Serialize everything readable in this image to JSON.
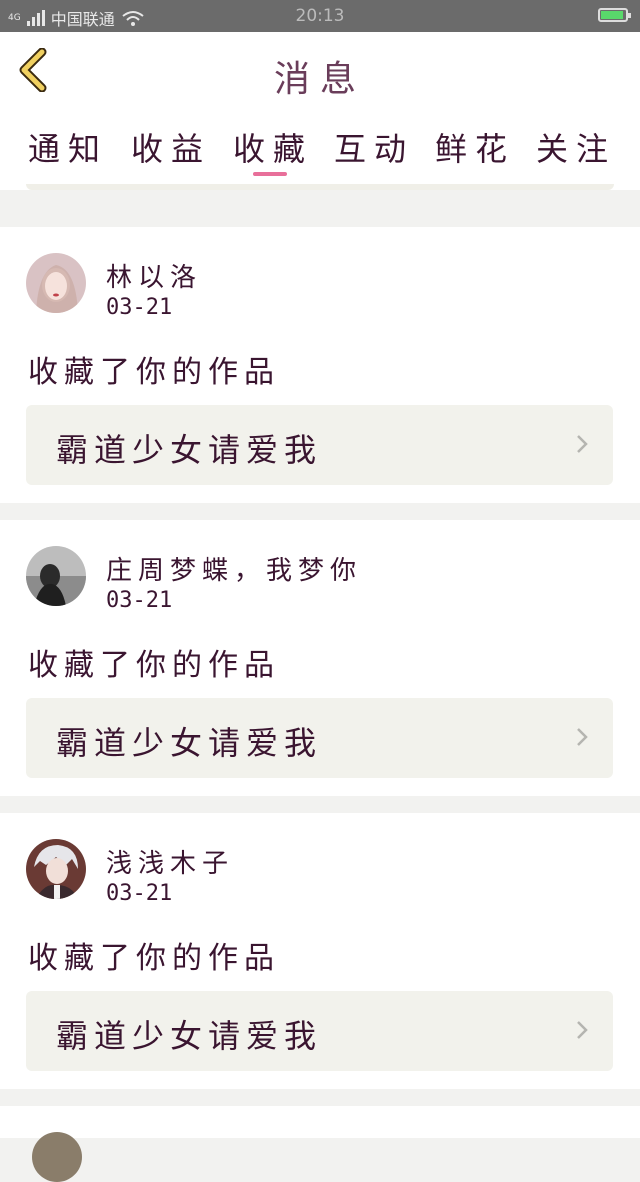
{
  "status_bar": {
    "network": "4G",
    "carrier": "中国联通",
    "time": "20:13",
    "battery_color": "#59d86b"
  },
  "header": {
    "title": "消息",
    "back_icon": "chevron-left-icon",
    "accent": "#f0d060"
  },
  "tabs": {
    "items": [
      "通知",
      "收益",
      "收藏",
      "互动",
      "鲜花",
      "关注"
    ],
    "active": "收藏",
    "indicator_color": "#e86f9a"
  },
  "messages": [
    {
      "user": "林以洛",
      "date": "03-21",
      "action": "收藏了你的作品",
      "work_title": "霸道少女请爱我"
    },
    {
      "user": "庄周梦蝶，我梦你",
      "date": "03-21",
      "action": "收藏了你的作品",
      "work_title": "霸道少女请爱我"
    },
    {
      "user": "浅浅木子",
      "date": "03-21",
      "action": "收藏了你的作品",
      "work_title": "霸道少女请爱我"
    }
  ]
}
